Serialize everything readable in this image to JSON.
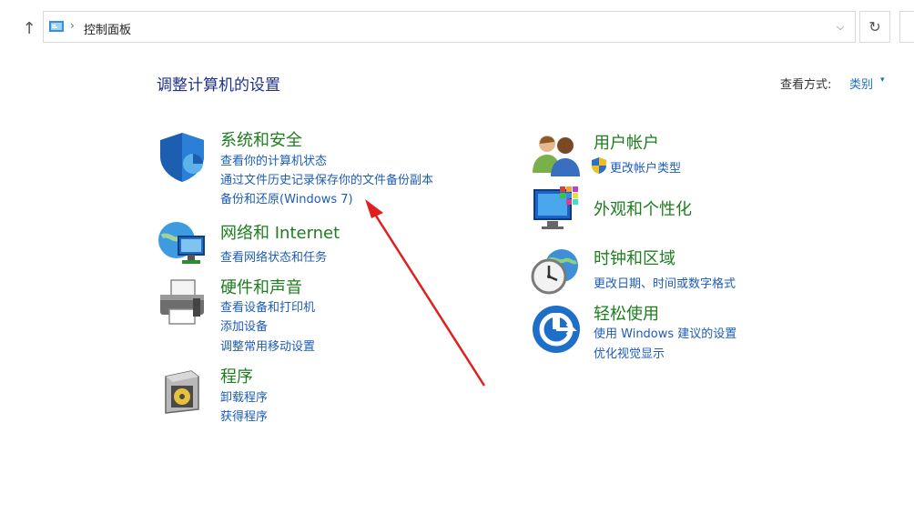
{
  "nav": {
    "up_icon": "up-arrow-icon",
    "breadcrumb": "控制面板",
    "separator": "›",
    "dropdown": "⌵",
    "refresh": "↻"
  },
  "header": {
    "title": "调整计算机的设置",
    "view_label": "查看方式:",
    "view_value": "类别",
    "view_caret": "▾"
  },
  "categories": {
    "system": {
      "title": "系统和安全",
      "links": [
        "查看你的计算机状态",
        "通过文件历史记录保存你的文件备份副本",
        "备份和还原(Windows 7)"
      ]
    },
    "network": {
      "title": "网络和 Internet",
      "links": [
        "查看网络状态和任务"
      ]
    },
    "hardware": {
      "title": "硬件和声音",
      "links": [
        "查看设备和打印机",
        "添加设备",
        "调整常用移动设置"
      ]
    },
    "programs": {
      "title": "程序",
      "links": [
        "卸载程序",
        "获得程序"
      ]
    },
    "users": {
      "title": "用户帐户",
      "links": [
        "更改帐户类型"
      ]
    },
    "appearance": {
      "title": "外观和个性化",
      "links": []
    },
    "clock": {
      "title": "时钟和区域",
      "links": [
        "更改日期、时间或数字格式"
      ]
    },
    "ease": {
      "title": "轻松使用",
      "links": [
        "使用 Windows 建议的设置",
        "优化视觉显示"
      ]
    }
  },
  "colors": {
    "title_green": "#1e7d1e",
    "link_blue": "#1d5cb8",
    "heading_blue": "#1e3287",
    "arrow_red": "#e02020"
  }
}
